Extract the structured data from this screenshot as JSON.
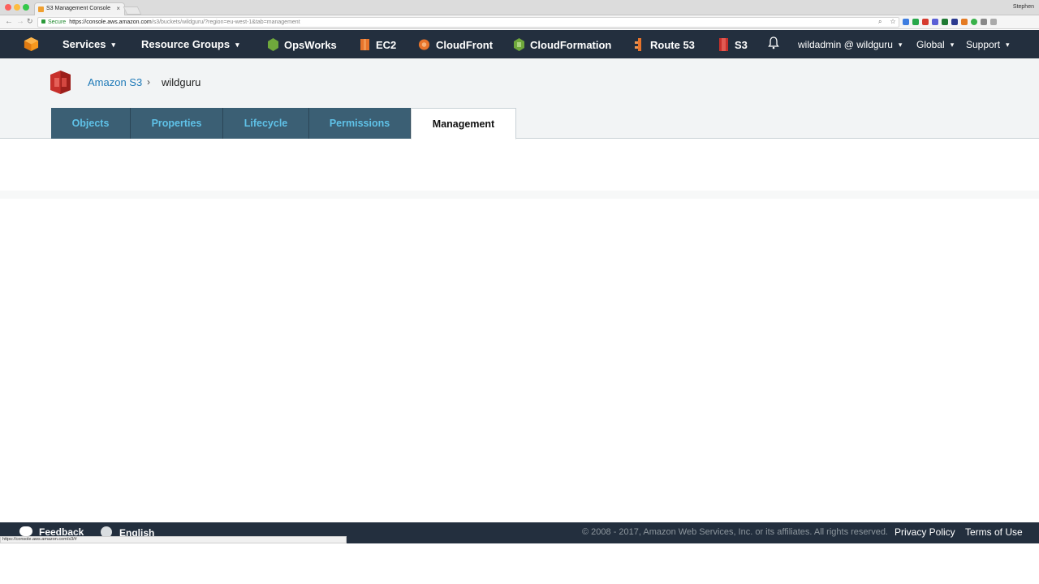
{
  "browser": {
    "tab_title": "S3 Management Console",
    "tab_close": "×",
    "profile_name": "Stephen",
    "secure_label": "Secure",
    "url_host": "https://console.aws.amazon.com",
    "url_path": "/s3/buckets/wildguru/?region=eu-west-1&tab=management",
    "omni_icons": "⌕ ☆",
    "nav_back": "←",
    "nav_forward": "→",
    "nav_reload": "↻",
    "status_url": "https://console.aws.amazon.com/s3/#"
  },
  "aws_nav": {
    "services": "Services",
    "resource_groups": "Resource Groups",
    "shortcuts": [
      "OpsWorks",
      "EC2",
      "CloudFront",
      "CloudFormation",
      "Route 53",
      "S3"
    ],
    "account": "wildadmin @ wildguru",
    "region": "Global",
    "support": "Support",
    "caret": "▾",
    "bell": "🔔"
  },
  "breadcrumb": {
    "root": "Amazon S3",
    "separator": "›",
    "current": "wildguru"
  },
  "tabs": [
    {
      "label": "Objects",
      "active": false
    },
    {
      "label": "Properties",
      "active": false
    },
    {
      "label": "Lifecycle",
      "active": false
    },
    {
      "label": "Permissions",
      "active": false
    },
    {
      "label": "Management",
      "active": true
    }
  ],
  "footer": {
    "feedback": "Feedback",
    "language": "English",
    "copyright": "© 2008 - 2017, Amazon Web Services, Inc. or its affiliates. All rights reserved.",
    "privacy": "Privacy Policy",
    "terms": "Terms of Use"
  },
  "colors": {
    "aws_nav_bg": "#232f3e",
    "tab_bg": "#3b5f74",
    "tab_text": "#5fc2e8",
    "link": "#1f7ab8"
  }
}
